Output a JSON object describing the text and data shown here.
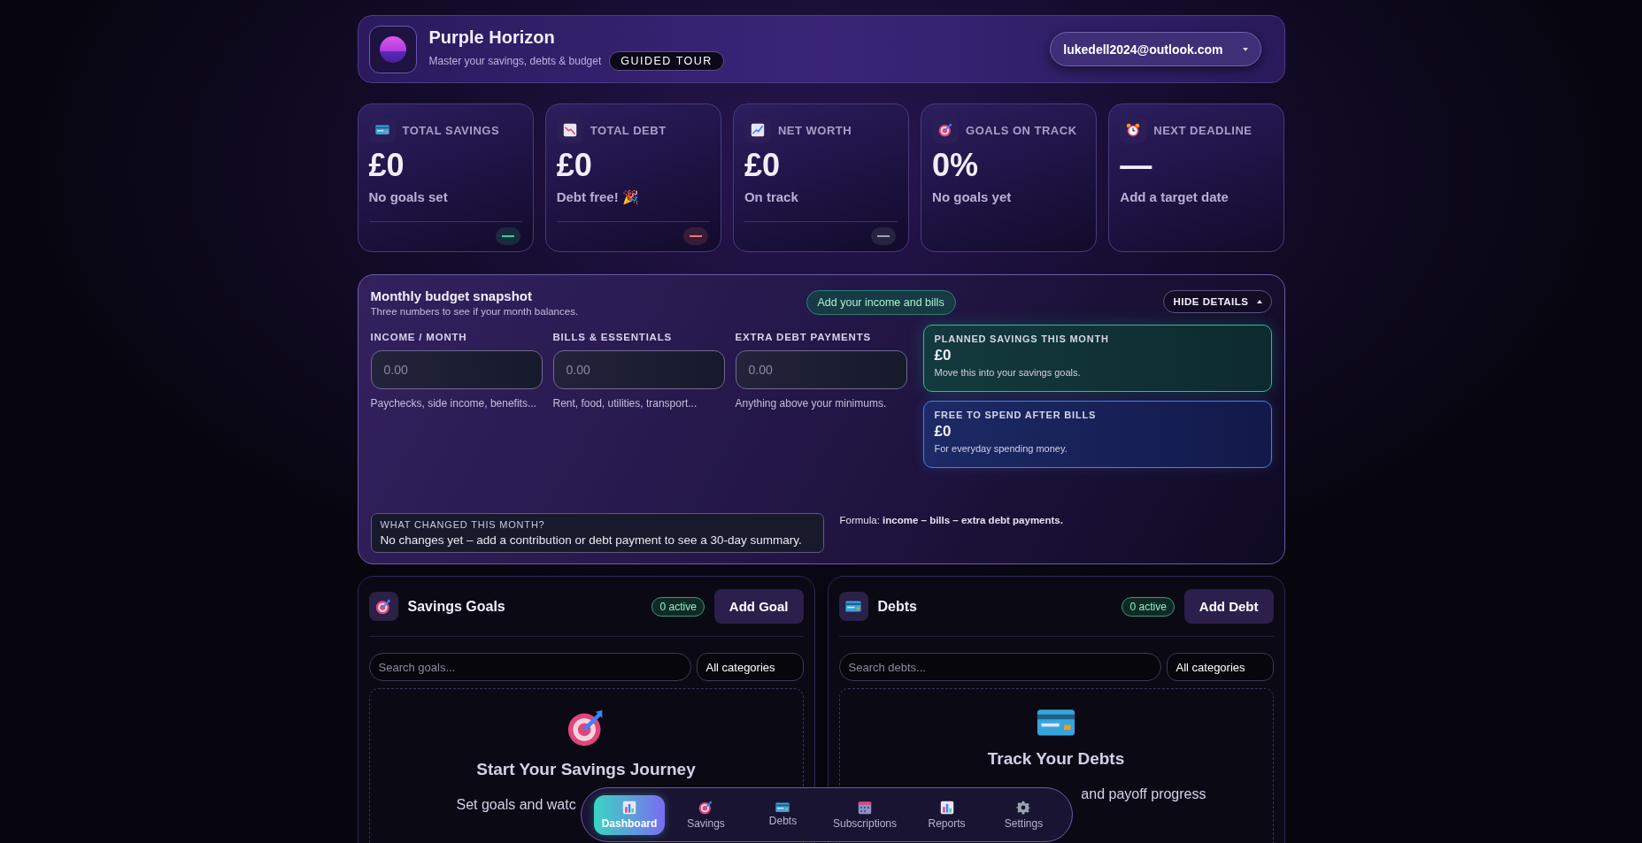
{
  "header": {
    "app_name": "Purple Horizon",
    "tagline": "Master your savings, debts & budget",
    "tour_button": "GUIDED TOUR",
    "account": "lukedell2024@outlook.com"
  },
  "stats": [
    {
      "kind": "card",
      "label": "TOTAL SAVINGS",
      "value": "£0",
      "note": "No goals set",
      "trend": {
        "color": "#34d399"
      }
    },
    {
      "kind": "chart-down",
      "label": "TOTAL DEBT",
      "value": "£0",
      "note": "Debt free! 🎉",
      "trend": {
        "color": "#f87171"
      }
    },
    {
      "kind": "chart-up",
      "label": "NET WORTH",
      "value": "£0",
      "note": "On track",
      "trend": {
        "color": "#9ca3af"
      }
    },
    {
      "kind": "target",
      "label": "GOALS ON TRACK",
      "value": "0%",
      "note": "No goals yet"
    },
    {
      "kind": "clock",
      "label": "NEXT DEADLINE",
      "value": "—",
      "note": "Add a target date"
    }
  ],
  "budget": {
    "title": "Monthly budget snapshot",
    "subtitle": "Three numbers to see if your month balances.",
    "prompt_button": "Add your income and bills",
    "toggle_button": "HIDE DETAILS",
    "expanded": true,
    "fields": [
      {
        "label": "INCOME / MONTH",
        "placeholder": "0.00",
        "hint": "Paychecks, side income, benefits..."
      },
      {
        "label": "BILLS & ESSENTIALS",
        "placeholder": "0.00",
        "hint": "Rent, food, utilities, transport..."
      },
      {
        "label": "EXTRA DEBT PAYMENTS",
        "placeholder": "0.00",
        "hint": "Anything above your minimums."
      }
    ],
    "summaries": [
      {
        "kind": "savings",
        "label": "PLANNED SAVINGS THIS MONTH",
        "value": "£0",
        "note": "Move this into your savings goals."
      },
      {
        "kind": "spend",
        "label": "FREE TO SPEND AFTER BILLS",
        "value": "£0",
        "note": "For everyday spending money."
      }
    ],
    "changes": {
      "label": "WHAT CHANGED THIS MONTH?",
      "text": "No changes yet – add a contribution or debt payment to see a 30-day summary."
    },
    "formula": "Formula: **income – bills – extra debt payments.**"
  },
  "panels": [
    {
      "kind": "target",
      "title": "Savings Goals",
      "badge": "0 active",
      "button": "Add Goal",
      "search_placeholder": "Search goals...",
      "filter": "All categories",
      "empty": {
        "heading": "Start Your Savings Journey",
        "text": "Set goals and watc"
      }
    },
    {
      "kind": "card",
      "title": "Debts",
      "badge": "0 active",
      "button": "Add Debt",
      "search_placeholder": "Search debts...",
      "filter": "All categories",
      "empty": {
        "heading": "Track Your Debts",
        "text": "and payoff progress"
      }
    }
  ],
  "nav": [
    {
      "kind": "chart",
      "label": "Dashboard",
      "selected": true
    },
    {
      "kind": "target",
      "label": "Savings",
      "selected": false
    },
    {
      "kind": "card",
      "label": "Debts",
      "selected": false
    },
    {
      "kind": "calendar",
      "label": "Subscriptions",
      "selected": false
    },
    {
      "kind": "chart",
      "label": "Reports",
      "selected": false
    },
    {
      "kind": "gear",
      "label": "Settings",
      "selected": false
    }
  ]
}
